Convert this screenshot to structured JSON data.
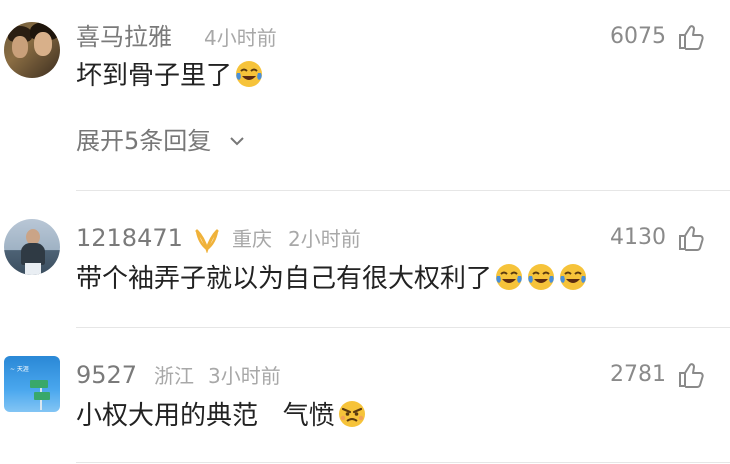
{
  "comments": [
    {
      "username": "喜马拉雅",
      "location": "",
      "time": "4小时前",
      "likes": "6075",
      "text": "坏到骨子里了",
      "emoji": [
        "laugh-cry"
      ],
      "replies_label": "展开5条回复"
    },
    {
      "username": "1218471",
      "location": "重庆",
      "time": "2小时前",
      "likes": "4130",
      "text": "带个袖弄子就以为自己有很大权利了",
      "emoji": [
        "laugh-cry",
        "laugh-cry",
        "laugh-cry"
      ]
    },
    {
      "username": "9527",
      "location": "浙江",
      "time": "3小时前",
      "likes": "2781",
      "text": "小权大用的典范   气愤",
      "emoji": [
        "angry-face"
      ]
    }
  ],
  "colors": {
    "username": "#7a7a7a",
    "meta": "#a8a8a8",
    "text": "#222222",
    "badge": "#f0b23a",
    "emoji_yellow": "#f6c33a",
    "emoji_blue": "#4a8fd8"
  }
}
